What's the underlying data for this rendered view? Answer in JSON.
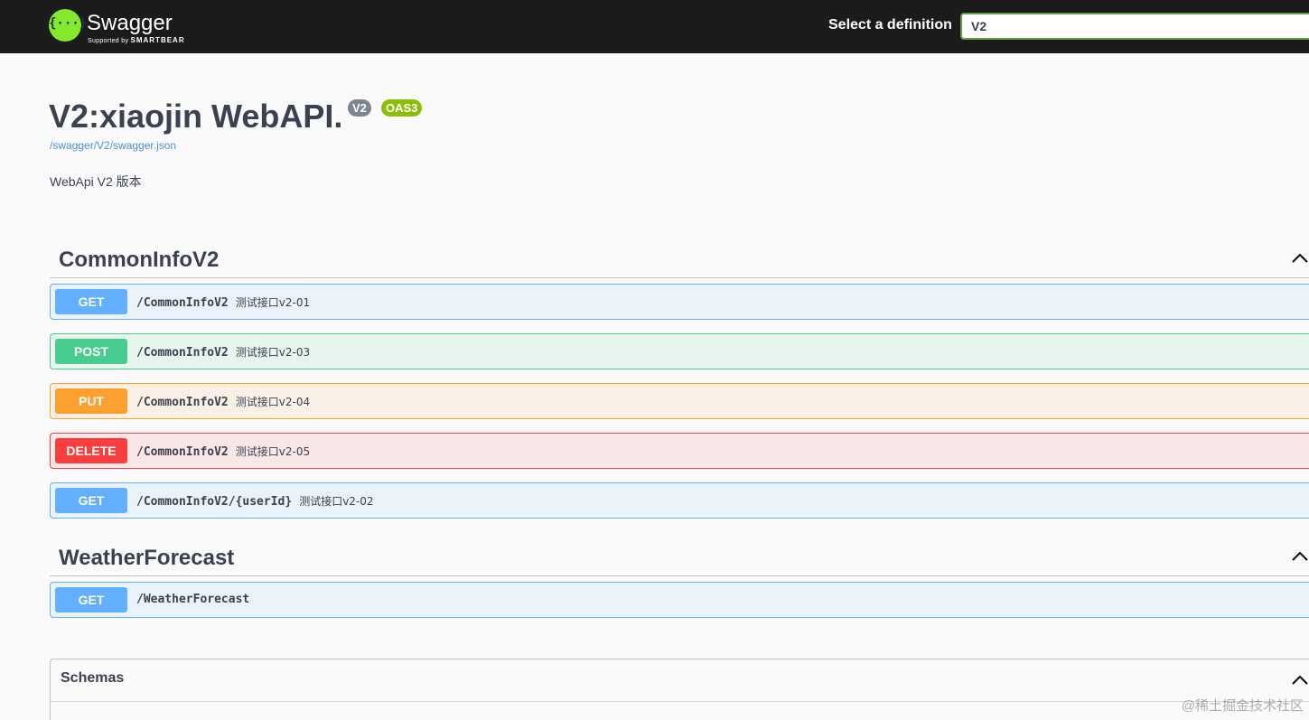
{
  "topbar": {
    "logo_glyph": "{···}",
    "logo_name": "Swagger",
    "logo_sub_prefix": "Supported by",
    "logo_sub_brand": "SMARTBEAR",
    "select_label": "Select a definition",
    "select_value": "V2"
  },
  "info": {
    "title": "V2:xiaojin WebAPI.",
    "version_badge": "V2",
    "oas_badge": "OAS3",
    "spec_link": "/swagger/V2/swagger.json",
    "description": "WebApi V2 版本"
  },
  "tags": [
    {
      "name": "CommonInfoV2",
      "operations": [
        {
          "method": "GET",
          "path": "/CommonInfoV2",
          "summary": "测试接口v2-01"
        },
        {
          "method": "POST",
          "path": "/CommonInfoV2",
          "summary": "测试接口v2-03"
        },
        {
          "method": "PUT",
          "path": "/CommonInfoV2",
          "summary": "测试接口v2-04"
        },
        {
          "method": "DELETE",
          "path": "/CommonInfoV2",
          "summary": "测试接口v2-05"
        },
        {
          "method": "GET",
          "path": "/CommonInfoV2/{userId}",
          "summary": "测试接口v2-02"
        }
      ]
    },
    {
      "name": "WeatherForecast",
      "operations": [
        {
          "method": "GET",
          "path": "/WeatherForecast",
          "summary": ""
        }
      ]
    }
  ],
  "schemas": {
    "title": "Schemas"
  },
  "watermark": "@稀土掘金技术社区",
  "colors": {
    "get": "#61affe",
    "post": "#49cc90",
    "put": "#fca130",
    "delete": "#f93e3e",
    "brand": "#85ea2d"
  }
}
